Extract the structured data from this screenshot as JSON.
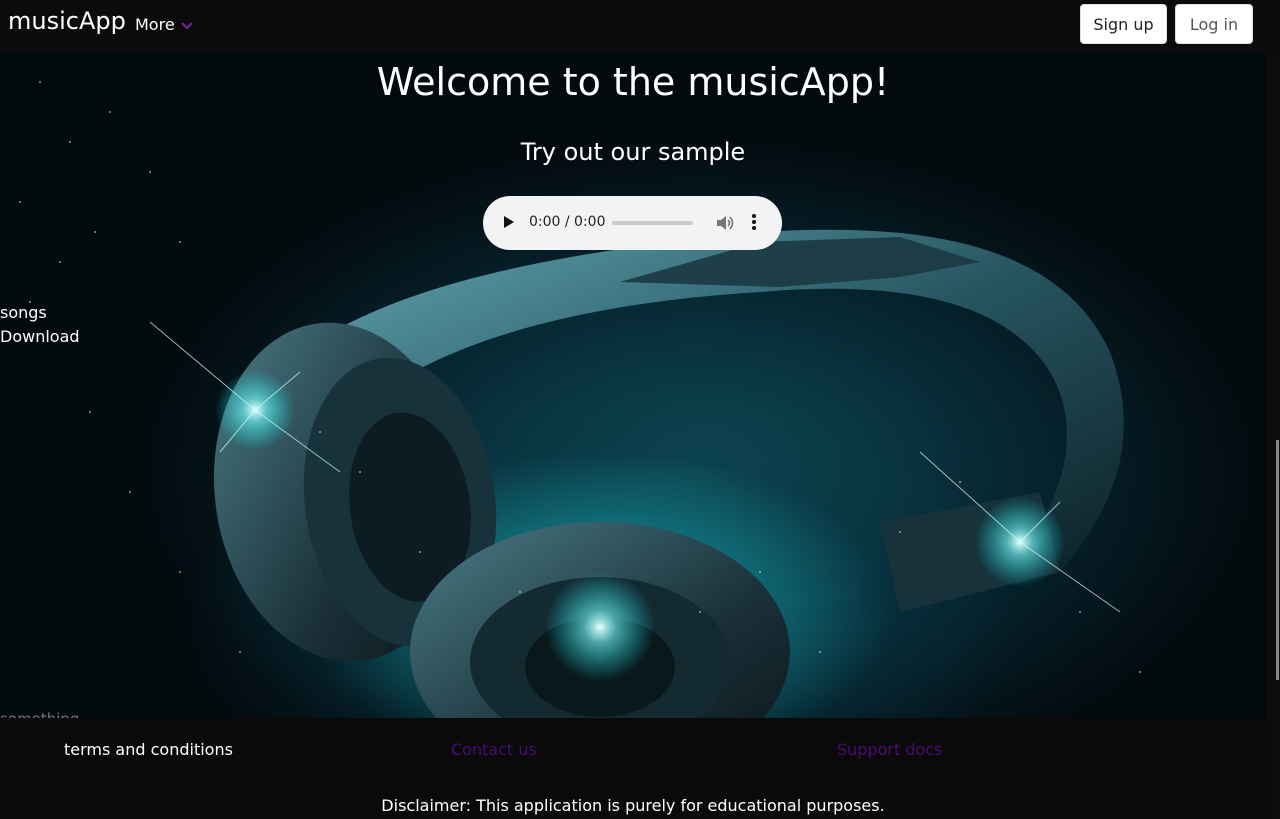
{
  "navbar": {
    "brand": "musicApp",
    "more_label": "More",
    "signup_label": "Sign up",
    "login_label": "Log in",
    "accent_color": "#7b1fa2"
  },
  "hero": {
    "title": "Welcome to the musicApp!",
    "subtitle": "Try out our sample",
    "player": {
      "time": "0:00 / 0:00",
      "progress": 0
    },
    "side_links": [
      "songs",
      "Download"
    ],
    "bottom_text": "something"
  },
  "footer": {
    "links": [
      "terms and conditions",
      "Contact us",
      "Support docs"
    ],
    "disclaimer": "Disclaimer: This application is purely for educational purposes.",
    "link_color": "#4a0a73"
  },
  "icons": {
    "dropdown": "chevron-down-icon",
    "play": "play-icon",
    "volume": "volume-icon",
    "menu": "more-vertical-icon"
  }
}
